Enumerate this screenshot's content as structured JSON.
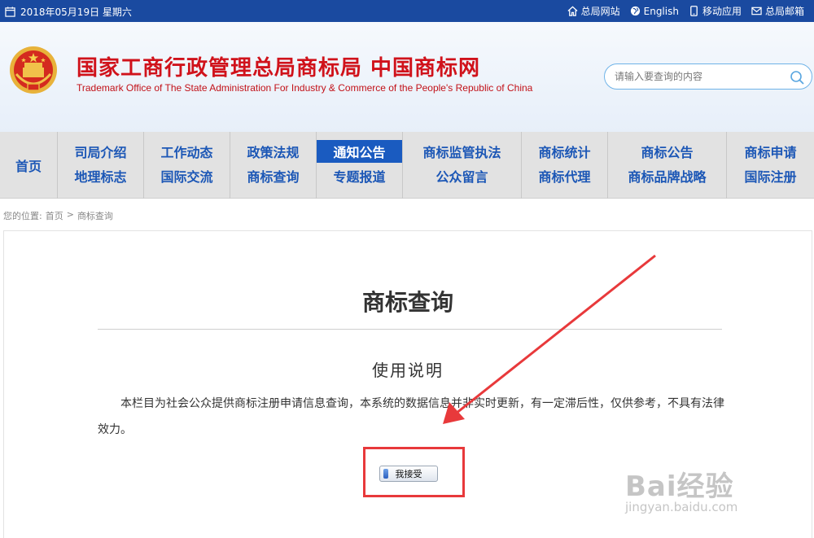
{
  "topbar": {
    "date": "2018年05月19日 星期六",
    "links": [
      {
        "label": "总局网站",
        "icon": "home-icon"
      },
      {
        "label": "English",
        "icon": "globe-icon"
      },
      {
        "label": "移动应用",
        "icon": "mobile-icon"
      },
      {
        "label": "总局邮箱",
        "icon": "mail-icon"
      }
    ]
  },
  "header": {
    "title_cn": "国家工商行政管理总局商标局 中国商标网",
    "title_en": "Trademark Office of The State Administration For Industry & Commerce of the People's Republic of China",
    "search_placeholder": "请输入要查询的内容"
  },
  "nav": {
    "home": "首页",
    "columns": [
      [
        "司局介绍",
        "地理标志"
      ],
      [
        "工作动态",
        "国际交流"
      ],
      [
        "政策法规",
        "商标查询"
      ],
      [
        "通知公告",
        "专题报道"
      ],
      [
        "商标监管执法",
        "公众留言"
      ],
      [
        "商标统计",
        "商标代理"
      ],
      [
        "商标公告",
        "商标品牌战略"
      ],
      [
        "商标申请",
        "国际注册"
      ]
    ],
    "active": "通知公告"
  },
  "breadcrumb": {
    "prefix": "您的位置:",
    "home": "首页",
    "separator": ">",
    "current": "商标查询"
  },
  "main": {
    "title": "商标查询",
    "section_title": "使用说明",
    "description": "本栏目为社会公众提供商标注册申请信息查询，本系统的数据信息并非实时更新，有一定滞后性，仅供参考，不具有法律效力。",
    "accept_label": "我接受"
  },
  "watermark": {
    "main": "Bai经验",
    "sub": "jingyan.baidu.com"
  },
  "colors": {
    "topbar": "#1a4aa0",
    "title_red": "#d0121b",
    "nav_text": "#1c57b6",
    "nav_active": "#1a5bc0",
    "annotation_red": "#e8393b"
  }
}
